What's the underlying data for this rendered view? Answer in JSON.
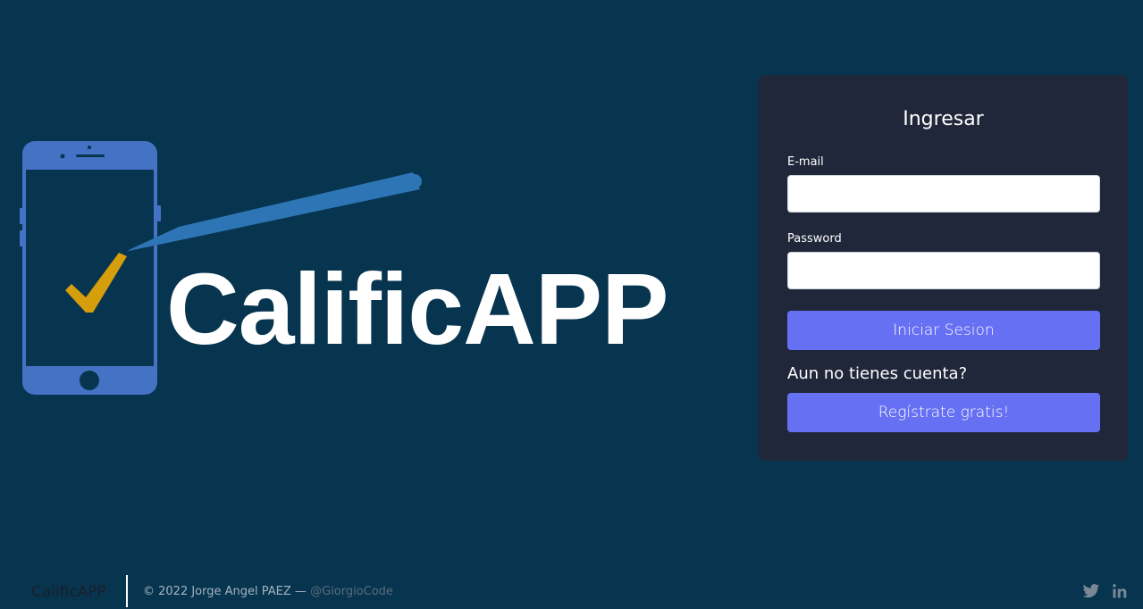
{
  "brand": {
    "title": "CalificAPP"
  },
  "login": {
    "title": "Ingresar",
    "email_label": "E-mail",
    "email_value": "",
    "password_label": "Password",
    "password_value": "",
    "submit_label": "Iniciar Sesion",
    "no_account_text": "Aun no tienes cuenta?",
    "register_label": "Regístrate gratis!"
  },
  "footer": {
    "brand": "CalificAPP",
    "copyright": "© 2022 Jorge Angel PAEZ —",
    "handle": "@GiorgioCode",
    "social": [
      "twitter-icon",
      "linkedin-icon"
    ]
  },
  "colors": {
    "background": "#07354f",
    "card": "#20273a",
    "button": "#6670f2",
    "phone": "#4472c4",
    "pen": "#2e75b6",
    "check": "#d69e0b"
  }
}
